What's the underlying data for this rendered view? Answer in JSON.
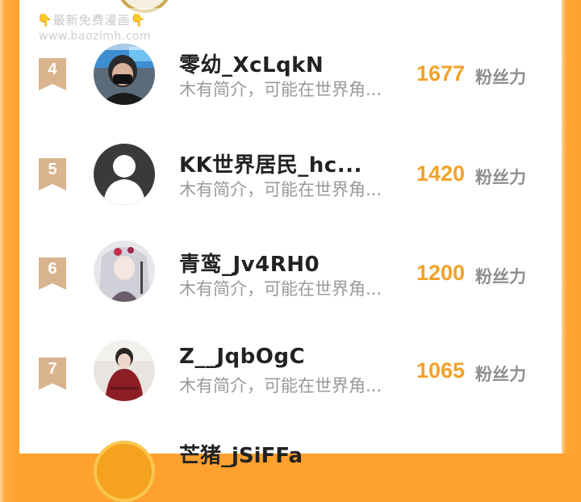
{
  "watermark": {
    "line1": "👇最新免费漫画👇",
    "line2": "www.baozimh.com"
  },
  "colors": {
    "accent": "#f2a22a",
    "frame": "#ffa12e",
    "badge": "#d9b48f"
  },
  "count_label": "粉丝力",
  "rows": [
    {
      "rank": "4",
      "name": "零幼_XcLqkN",
      "bio": "木有简介，可能在世界角...",
      "count": "1677",
      "avatar": "photo-masked-person"
    },
    {
      "rank": "5",
      "name": "KK世界居民_hc...",
      "bio": "木有简介，可能在世界角...",
      "count": "1420",
      "avatar": "default-user-icon"
    },
    {
      "rank": "6",
      "name": "青鸾_Jv4RH0",
      "bio": "木有简介，可能在世界角...",
      "count": "1200",
      "avatar": "anime-girl-white-hair"
    },
    {
      "rank": "7",
      "name": "Z__JqbOgC",
      "bio": "木有简介，可能在世界角...",
      "count": "1065",
      "avatar": "photo-girl-red-dress"
    }
  ],
  "partial_row": {
    "name": "芒猪_jSiFFa"
  }
}
